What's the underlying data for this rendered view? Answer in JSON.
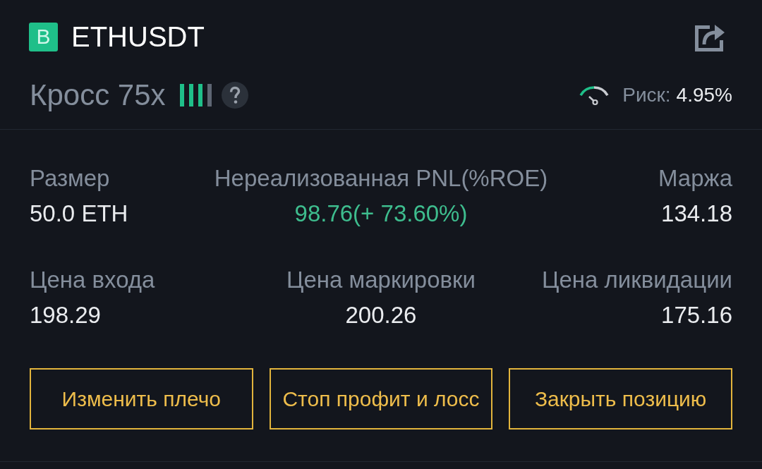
{
  "header": {
    "badge": "B",
    "symbol": "ETHUSDT"
  },
  "margin_mode": {
    "label": "Кросс 75x",
    "leverage": {
      "level": 0.75
    }
  },
  "risk": {
    "label": "Риск:",
    "value": "4.95%"
  },
  "stat_rows": [
    [
      {
        "label": "Размер",
        "value": "50.0 ETH",
        "kind": "plain"
      },
      {
        "label": "Нереализованная PNL(%ROE)",
        "value": "98.76(+ 73.60%)",
        "kind": "profit"
      },
      {
        "label": "Маржа",
        "value": "134.18",
        "kind": "plain"
      }
    ],
    [
      {
        "label": "Цена входа",
        "value": "198.29",
        "kind": "plain"
      },
      {
        "label": "Цена маркировки",
        "value": "200.26",
        "kind": "plain"
      },
      {
        "label": "Цена ликвидации",
        "value": "175.16",
        "kind": "plain"
      }
    ]
  ],
  "buttons": [
    "Изменить плечо",
    "Стоп профит и лосс",
    "Закрыть позицию"
  ]
}
